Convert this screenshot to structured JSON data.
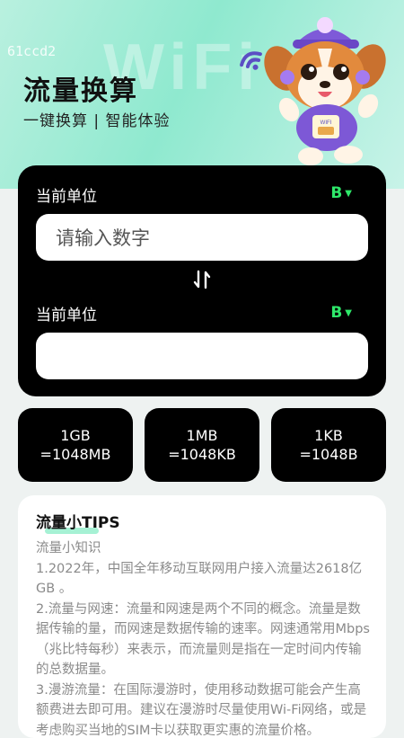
{
  "header": {
    "watermark": "61ccd2",
    "bg_text": "WiFi",
    "title": "流量换算",
    "subtitle": "一键换算 | 智能体验",
    "mascot_badge": "WIFI"
  },
  "converter": {
    "top_label": "当前单位",
    "top_unit": "B",
    "input_placeholder": "请输入数字",
    "bottom_label": "当前单位",
    "bottom_unit": "B",
    "output_value": ""
  },
  "cards": [
    {
      "line1": "1GB",
      "line2": "=1048MB"
    },
    {
      "line1": "1MB",
      "line2": "=1048KB"
    },
    {
      "line1": "1KB",
      "line2": "=1048B"
    }
  ],
  "tips": {
    "title": "流量小TIPS",
    "heading": "流量小知识",
    "items": [
      "1.2022年，中国全年移动互联网用户接入流量达2618亿GB 。",
      "2.流量与网速：流量和网速是两个不同的概念。流量是数据传输的量，而网速是数据传输的速率。网速通常用Mbps（兆比特每秒）来表示，而流量则是指在一定时间内传输的总数据量。",
      "3.漫游流量：在国际漫游时，使用移动数据可能会产生高额费进去即可用。建议在漫游时尽量使用Wi-Fi网络，或是考虑购买当地的SIM卡以获取更实惠的流量价格。"
    ]
  },
  "colors": {
    "accent_green": "#2ee86a",
    "hero_mint": "#8fe9cf",
    "card_black": "#000000"
  }
}
